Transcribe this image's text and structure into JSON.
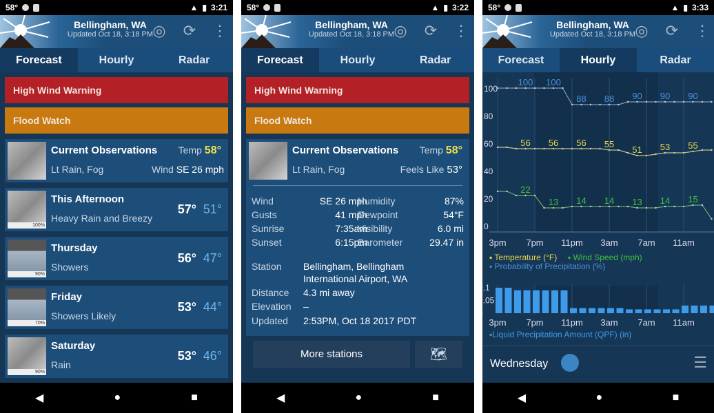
{
  "screens": [
    {
      "time": "3:21"
    },
    {
      "time": "3:22"
    },
    {
      "time": "3:33"
    }
  ],
  "status": {
    "temp": "58°"
  },
  "header": {
    "title": "Bellingham, WA",
    "updated": "Updated Oct 18, 3:18 PM"
  },
  "tabs": [
    "Forecast",
    "Hourly",
    "Radar"
  ],
  "alerts": {
    "red": "High Wind Warning",
    "orange": "Flood Watch"
  },
  "current": {
    "title": "Current Observations",
    "condition": "Lt Rain, Fog",
    "temp_label": "Temp",
    "temp": "58°",
    "wind_label": "Wind",
    "wind": "SE 26 mph",
    "feels_label": "Feels Like",
    "feels": "53°"
  },
  "forecast": [
    {
      "day": "This Afternoon",
      "cond": "Heavy Rain and Breezy",
      "hi": "57°",
      "lo": "51°",
      "pop": "100%",
      "icon": "rain"
    },
    {
      "day": "Thursday",
      "cond": "Showers",
      "hi": "56°",
      "lo": "47°",
      "pop": "90%",
      "icon": "showers"
    },
    {
      "day": "Friday",
      "cond": "Showers Likely",
      "hi": "53°",
      "lo": "44°",
      "pop": "70%",
      "icon": "showers"
    },
    {
      "day": "Saturday",
      "cond": "Rain",
      "hi": "53°",
      "lo": "46°",
      "pop": "90%",
      "icon": "rain"
    }
  ],
  "details": {
    "rows": [
      [
        "Wind",
        "SE 26 mph",
        "Humidity",
        "87%"
      ],
      [
        "Gusts",
        "41 mph",
        "Dewpoint",
        "54°F"
      ],
      [
        "Sunrise",
        "7:35am",
        "Visibility",
        "6.0 mi"
      ],
      [
        "Sunset",
        "6:15pm",
        "Barometer",
        "29.47 in"
      ]
    ],
    "station_label": "Station",
    "station": "Bellingham, Bellingham",
    "station2": "International Airport, WA",
    "distance_label": "Distance",
    "distance": "4.3 mi away",
    "elevation_label": "Elevation",
    "elevation": "–",
    "updated_label": "Updated",
    "updated": "2:53PM, Oct 18 2017 PDT",
    "more_stations": "More stations"
  },
  "hourly": {
    "day": "Wednesday"
  },
  "chart_data": [
    {
      "type": "line",
      "ylim": [
        0,
        100
      ],
      "yticks": [
        0,
        20,
        40,
        60,
        80,
        100
      ],
      "x": [
        "3pm",
        "4pm",
        "5pm",
        "6pm",
        "7pm",
        "8pm",
        "9pm",
        "10pm",
        "11pm",
        "12am",
        "1am",
        "2am",
        "3am",
        "4am",
        "5am",
        "6am",
        "7am",
        "8am",
        "9am",
        "10am",
        "11am",
        "12pm",
        "1pm",
        "2pm"
      ],
      "xticks": [
        "3pm",
        "7pm",
        "11pm",
        "3am",
        "7am",
        "11am"
      ],
      "series": [
        {
          "name": "Temperature (°F)",
          "color": "#e6d84a",
          "values": [
            57,
            57,
            56,
            56,
            56,
            56,
            56,
            56,
            56,
            56,
            56,
            56,
            55,
            55,
            53,
            51,
            51,
            52,
            53,
            53,
            53,
            54,
            55,
            55
          ],
          "labels": {
            "3": "56",
            "6": "56",
            "9": "56",
            "12": "55",
            "15": "51",
            "18": "53",
            "21": "55"
          }
        },
        {
          "name": "Wind Speed (mph)",
          "color": "#3fc23f",
          "values": [
            25,
            25,
            22,
            22,
            22,
            13,
            13,
            13,
            14,
            14,
            14,
            14,
            14,
            14,
            14,
            13,
            13,
            13,
            14,
            14,
            14,
            15,
            15,
            5
          ],
          "labels": {
            "3": "22",
            "6": "13",
            "9": "14",
            "12": "14",
            "15": "13",
            "18": "14",
            "21": "15"
          }
        },
        {
          "name": "Probability of Precipitation (%)",
          "color": "#4d8fd6",
          "values": [
            100,
            100,
            100,
            100,
            100,
            100,
            100,
            100,
            88,
            88,
            88,
            88,
            88,
            88,
            90,
            90,
            90,
            90,
            90,
            90,
            90,
            90,
            90,
            90
          ],
          "labels": {
            "3": "100",
            "6": "100",
            "9": "88",
            "12": "88",
            "15": "90",
            "18": "90",
            "21": "90"
          }
        }
      ]
    },
    {
      "type": "bar",
      "ylim": [
        0,
        0.1
      ],
      "yticks": [
        "0",
        "0.05",
        "0.1"
      ],
      "xticks": [
        "3pm",
        "7pm",
        "11pm",
        "3am",
        "7am",
        "11am"
      ],
      "series": [
        {
          "name": "Liquid Precipitation Amount (QPF) (in)",
          "color": "#3d9be9",
          "values": [
            0.1,
            0.1,
            0.09,
            0.09,
            0.09,
            0.09,
            0.09,
            0.09,
            0.02,
            0.02,
            0.02,
            0.02,
            0.02,
            0.02,
            0.015,
            0.015,
            0.015,
            0.015,
            0.015,
            0.015,
            0.03,
            0.03,
            0.03,
            0.03
          ]
        }
      ]
    }
  ]
}
